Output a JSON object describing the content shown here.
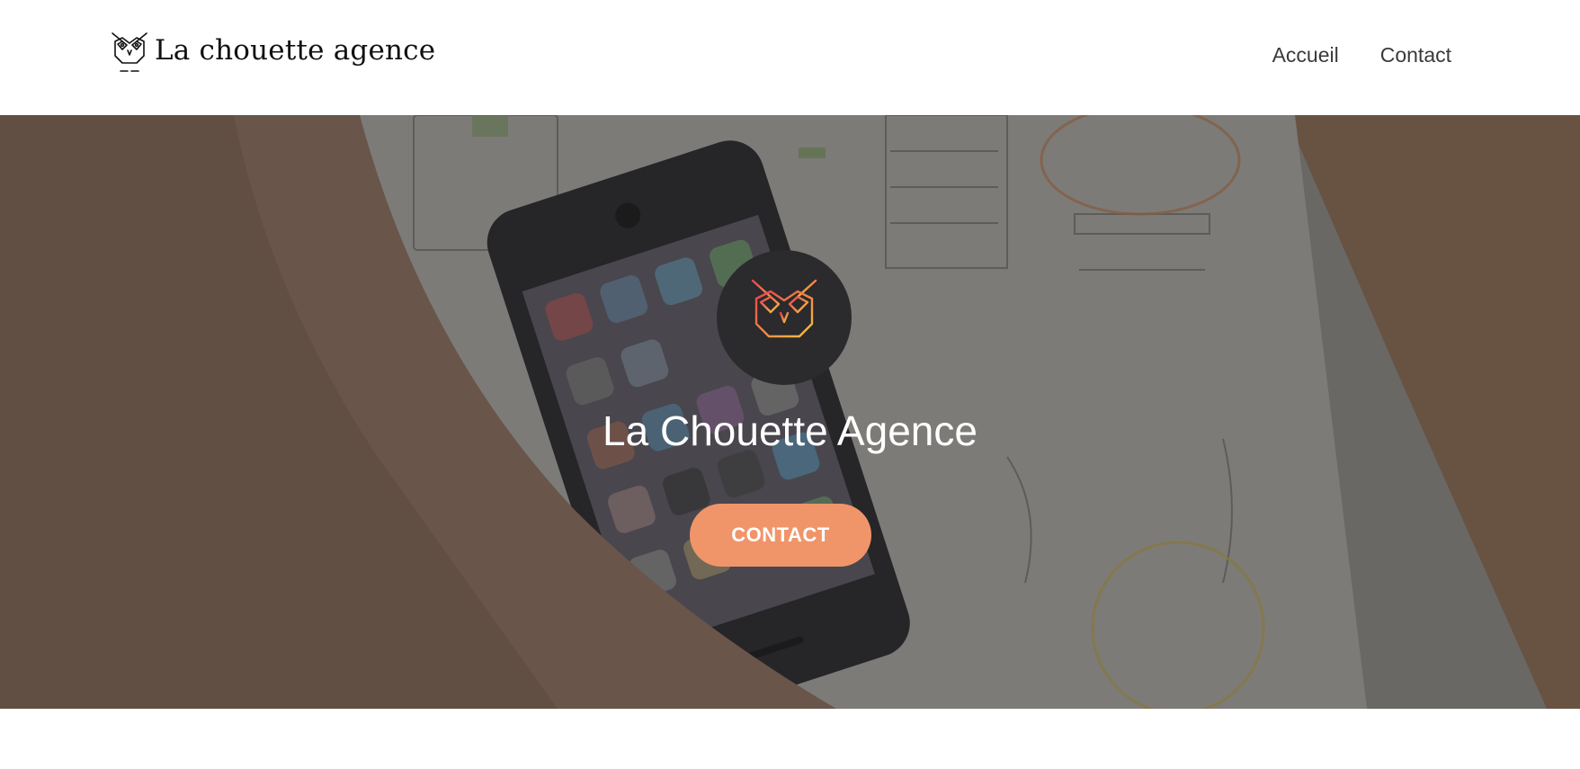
{
  "header": {
    "brand_name": "La chouette agence",
    "logo_icon": "owl-icon",
    "nav": [
      {
        "label": "Accueil"
      },
      {
        "label": "Contact"
      }
    ]
  },
  "hero": {
    "title": "La Chouette Agence",
    "cta_label": "CONTACT",
    "emblem_icon": "owl-gradient-icon",
    "background": "photo of hand holding smartphone over app wireframe sketches",
    "colors": {
      "accent": "#f0956a",
      "emblem_bg": "#2b2a2c",
      "owl_gradient_start": "#e8454e",
      "owl_gradient_end": "#f6c244"
    }
  }
}
